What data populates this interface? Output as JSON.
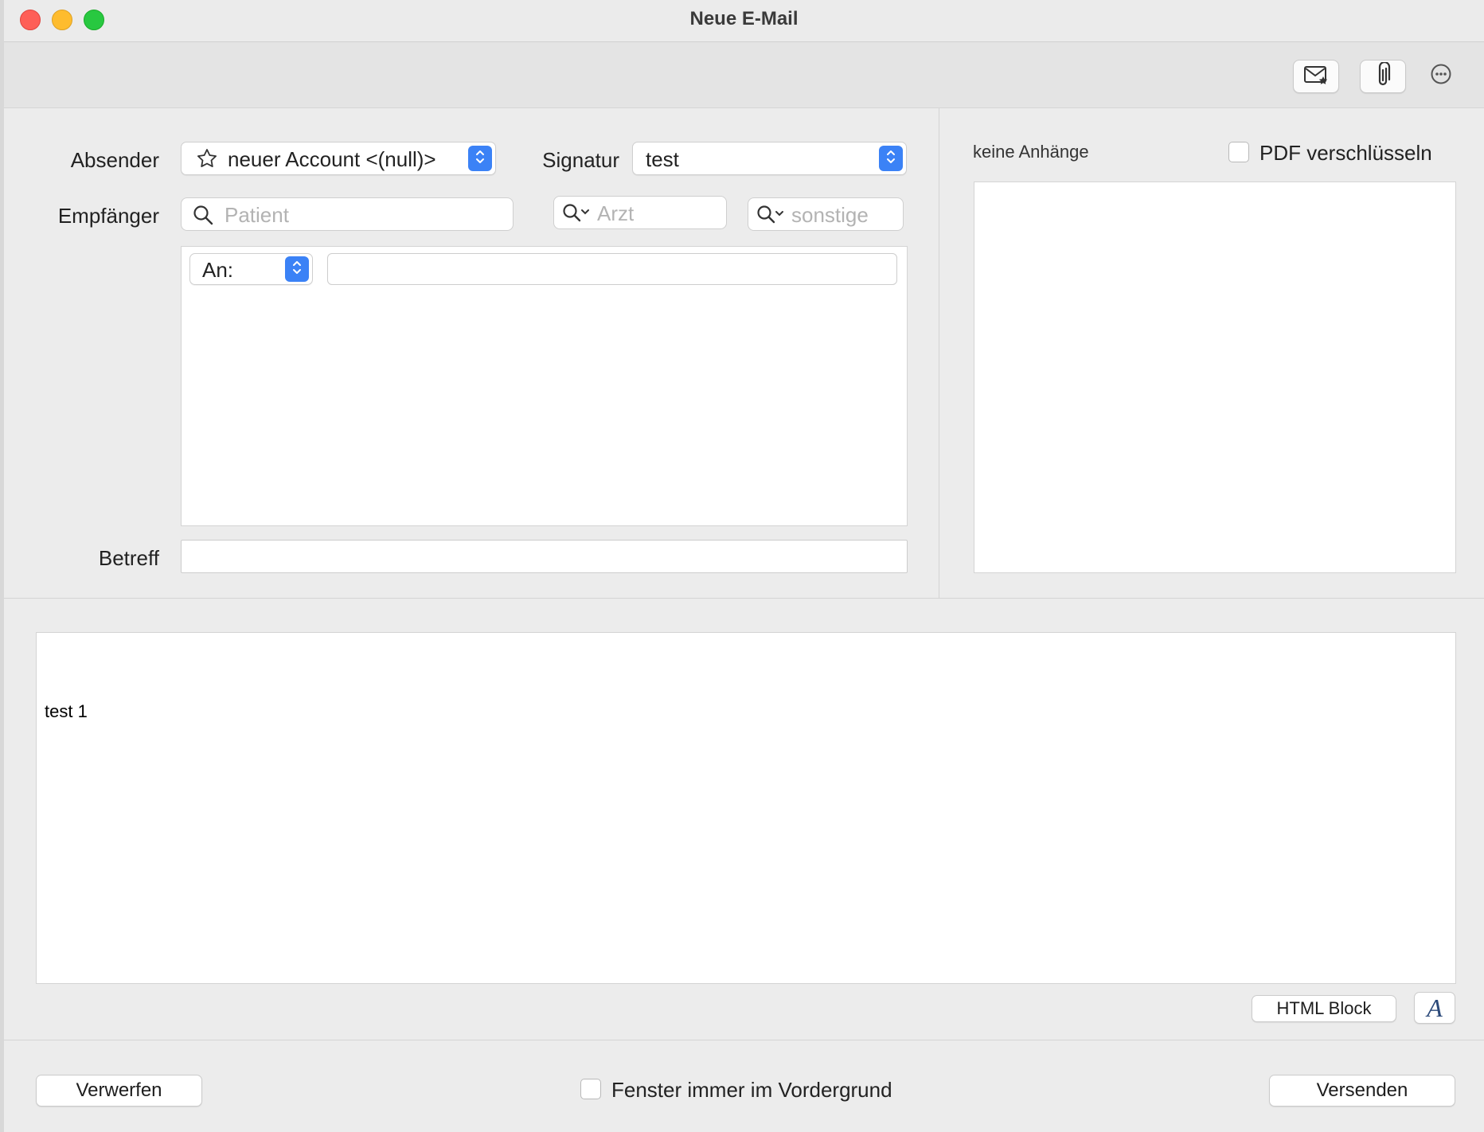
{
  "window": {
    "title": "Neue E-Mail"
  },
  "form": {
    "sender_label": "Absender",
    "sender_value": "neuer Account <(null)>",
    "signature_label": "Signatur",
    "signature_value": "test",
    "recipient_label": "Empfänger",
    "patient_placeholder": "Patient",
    "arzt_placeholder": "Arzt",
    "sonstige_placeholder": "sonstige",
    "to_type": "An:",
    "to_value": "",
    "subject_label": "Betreff",
    "subject_value": ""
  },
  "attachments": {
    "status": "keine Anhänge",
    "pdf_encrypt_label": "PDF verschlüsseln",
    "pdf_encrypt_checked": false
  },
  "body": {
    "text": "test 1"
  },
  "editor_tools": {
    "html_block_label": "HTML Block",
    "font_label": "A"
  },
  "footer": {
    "discard_label": "Verwerfen",
    "always_on_top_label": "Fenster immer im Vordergrund",
    "always_on_top_checked": false,
    "send_label": "Versenden"
  },
  "icons": {
    "toolbar": [
      "mail-star-icon",
      "paperclip-icon",
      "more-icon"
    ],
    "accent": "#3b82f6"
  }
}
